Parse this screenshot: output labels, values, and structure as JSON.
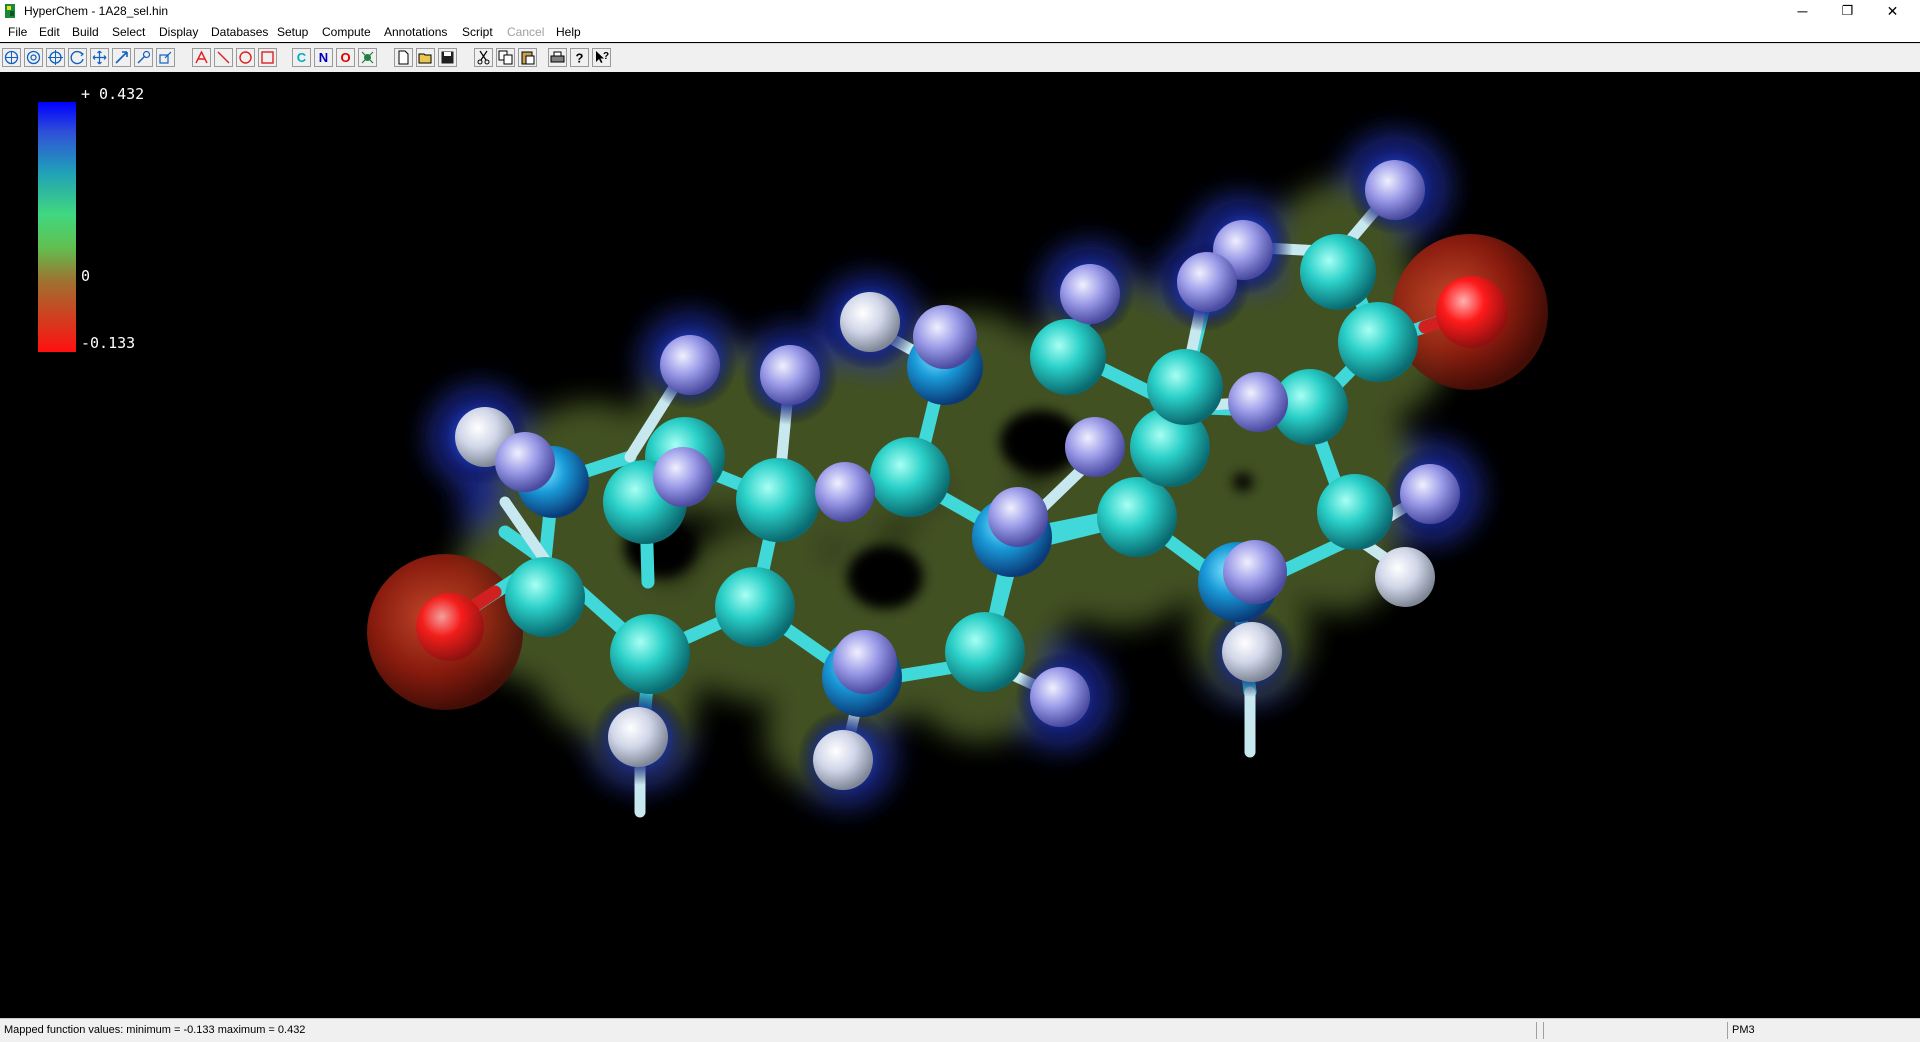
{
  "window": {
    "title": "HyperChem - 1A28_sel.hin",
    "minimize_label": "─",
    "restore_label": "❐",
    "close_label": "✕"
  },
  "menu": {
    "items": [
      {
        "label": "File"
      },
      {
        "label": "Edit"
      },
      {
        "label": "Build"
      },
      {
        "label": "Select"
      },
      {
        "label": "Display"
      },
      {
        "label": "Databases"
      },
      {
        "label": "Setup"
      },
      {
        "label": "Compute"
      },
      {
        "label": "Annotations"
      },
      {
        "label": "Script"
      },
      {
        "label": "Cancel",
        "disabled": true
      },
      {
        "label": "Help"
      }
    ]
  },
  "toolbar": {
    "element_buttons": [
      {
        "label": "C",
        "color": "#00b0c0"
      },
      {
        "label": "N",
        "color": "#0000c0"
      },
      {
        "label": "O",
        "color": "#e00000"
      }
    ]
  },
  "legend": {
    "max_label": "+ 0.432",
    "zero_label": "0",
    "min_label": "-0.133"
  },
  "colors": {
    "carbon": "#2ad0c8",
    "hydrogen_blue": "#9a9ae8",
    "hydrogen_white": "#d8dce8",
    "oxygen": "#ff1a1a",
    "bond": "#40d8d8"
  },
  "status": {
    "message": "Mapped function values: minimum = -0.133 maximum = 0.432",
    "method": "PM3"
  }
}
